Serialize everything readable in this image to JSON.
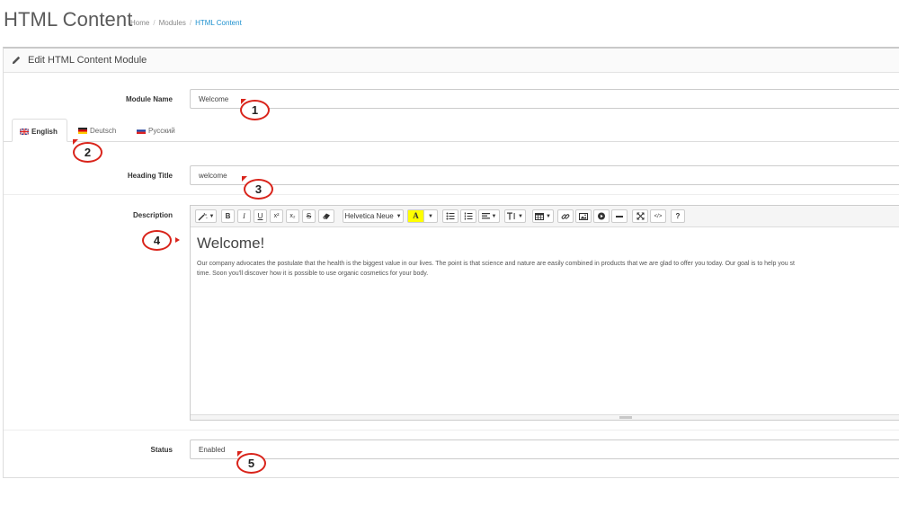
{
  "page": {
    "title": "HTML Content"
  },
  "breadcrumb": {
    "items": [
      "Home",
      "Modules",
      "HTML Content"
    ]
  },
  "panel": {
    "heading": "Edit HTML Content Module",
    "heading_icon": "pencil-icon"
  },
  "form": {
    "module_name": {
      "label": "Module Name",
      "value": "Welcome"
    },
    "languages": [
      {
        "label": "English",
        "flag": "uk-flag-icon",
        "active": true
      },
      {
        "label": "Deutsch",
        "flag": "de-flag-icon",
        "active": false
      },
      {
        "label": "Русский",
        "flag": "ru-flag-icon",
        "active": false
      }
    ],
    "heading_title": {
      "label": "Heading Title",
      "value": "welcome"
    },
    "description": {
      "label": "Description",
      "heading": "Welcome!",
      "line1": "Our company advocates the postulate that the health is the biggest value in our lives. The point is that science and nature are easily combined in products that we are glad to offer you today. Our goal is to help you st",
      "line2": "time. Soon you'll discover how it is possible to use organic cosmetics for your body."
    },
    "status": {
      "label": "Status",
      "value": "Enabled"
    }
  },
  "toolbar": {
    "font_name": "Helvetica Neue",
    "buttons": [
      {
        "name": "style-button",
        "icon": "magic-icon"
      },
      {
        "name": "bold-button",
        "glyph": "B"
      },
      {
        "name": "italic-button",
        "glyph": "I"
      },
      {
        "name": "underline-button",
        "glyph": "U"
      },
      {
        "name": "superscript-button",
        "glyph": "x²"
      },
      {
        "name": "subscript-button",
        "glyph": "x₂"
      },
      {
        "name": "strikethrough-button",
        "glyph": "S"
      },
      {
        "name": "clear-format-button",
        "icon": "eraser-icon"
      },
      {
        "name": "font-name-dropdown"
      },
      {
        "name": "color-button",
        "glyph": "A"
      },
      {
        "name": "unordered-list-button",
        "icon": "list-ul-icon"
      },
      {
        "name": "ordered-list-button",
        "icon": "list-ol-icon"
      },
      {
        "name": "paragraph-button",
        "icon": "align-left-icon"
      },
      {
        "name": "line-height-button",
        "icon": "text-height-icon"
      },
      {
        "name": "table-button",
        "icon": "table-icon"
      },
      {
        "name": "link-button",
        "icon": "link-icon"
      },
      {
        "name": "image-button",
        "icon": "picture-icon"
      },
      {
        "name": "video-button",
        "icon": "video-icon"
      },
      {
        "name": "hr-button",
        "icon": "minus-icon"
      },
      {
        "name": "fullscreen-button",
        "icon": "expand-icon"
      },
      {
        "name": "codeview-button",
        "glyph": "</>"
      },
      {
        "name": "help-button",
        "glyph": "?"
      }
    ]
  },
  "callouts": [
    "1",
    "2",
    "3",
    "4",
    "5"
  ],
  "colors": {
    "accent": "#1e91cf",
    "callout": "#d9241b"
  }
}
